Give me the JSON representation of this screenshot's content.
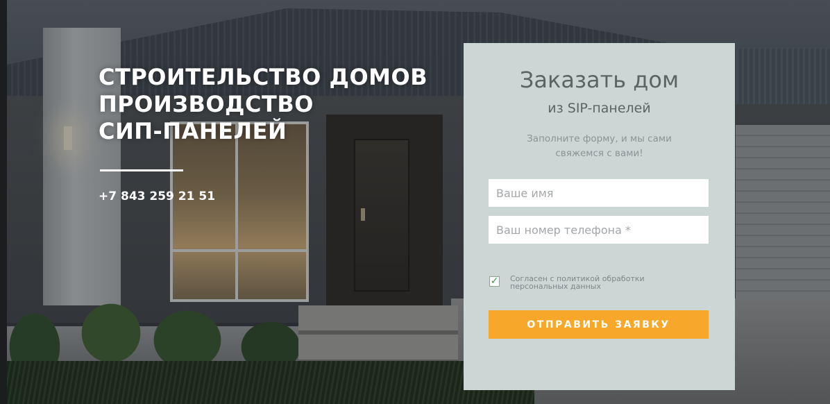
{
  "hero": {
    "title_line1": "СТРОИТЕЛЬСТВО ДОМОВ",
    "title_line2": "ПРОИЗВОДСТВО",
    "title_line3": "СИП-ПАНЕЛЕЙ",
    "phone": "+7 843 259 21 51"
  },
  "form": {
    "title": "Заказать дом",
    "subtitle": "из SIP-панелей",
    "note_line1": "Заполните форму, и мы сами",
    "note_line2": "свяжемся с вами!",
    "name_placeholder": "Ваше имя",
    "name_value": "",
    "phone_placeholder": "Ваш номер телефона *",
    "phone_value": "",
    "consent_checked": true,
    "consent_line1": "Согласен с политикой обработки",
    "consent_line2": "персональных данных",
    "submit_label": "ОТПРАВИТЬ ЗАЯВКУ"
  },
  "colors": {
    "card_background": "#ccd6d4",
    "submit_button": "#f7a72a",
    "heading_text": "#5d6466",
    "checkmark": "#33a04a"
  }
}
